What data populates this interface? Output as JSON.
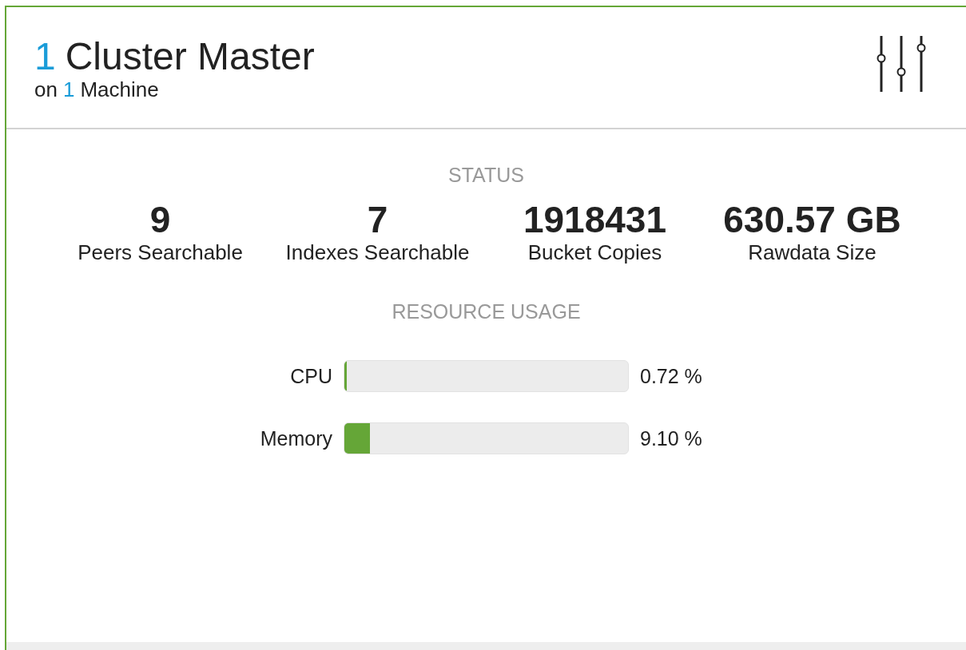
{
  "header": {
    "count": "1",
    "title": "Cluster Master",
    "subtitle_prefix": "on",
    "machine_count": "1",
    "subtitle_suffix": "Machine"
  },
  "status": {
    "heading": "STATUS",
    "stats": [
      {
        "value": "9",
        "label": "Peers Searchable"
      },
      {
        "value": "7",
        "label": "Indexes Searchable"
      },
      {
        "value": "1918431",
        "label": "Bucket Copies"
      },
      {
        "value": "630.57 GB",
        "label": "Rawdata Size"
      }
    ]
  },
  "resource_usage": {
    "heading": "RESOURCE USAGE",
    "meters": [
      {
        "name": "CPU",
        "level": 0.0072,
        "reading": "0.72 %"
      },
      {
        "name": "Memory",
        "level": 0.091,
        "reading": "9.10 %"
      }
    ]
  }
}
